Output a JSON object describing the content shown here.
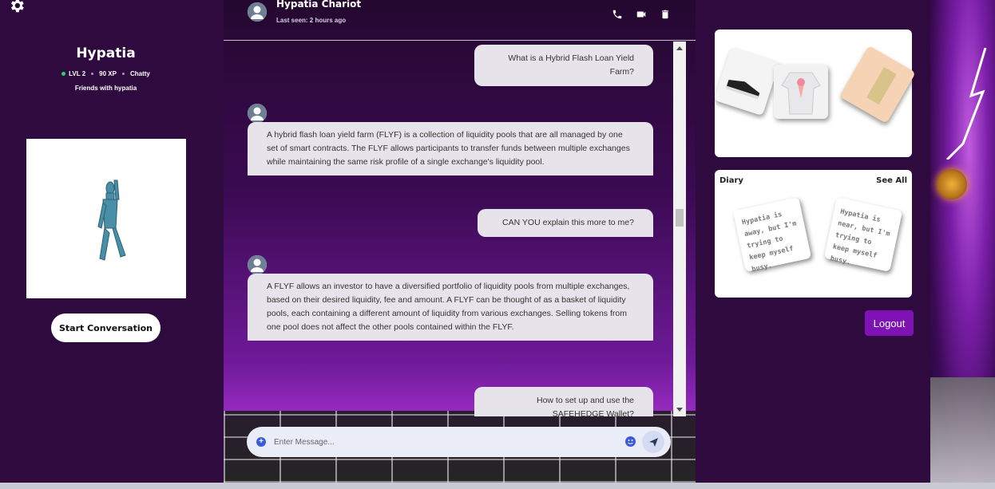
{
  "profile": {
    "name": "Hypatia",
    "level": "LVL 2",
    "xp": "90 XP",
    "mood": "Chatty",
    "friends": "Friends with hypatia",
    "start_button": "Start Conversation"
  },
  "chat": {
    "contact_name": "Hypatia Chariot",
    "last_seen": "Last seen: 2 hours ago",
    "messages": [
      {
        "from": "user",
        "text": "What is a Hybrid Flash Loan Yield Farm?"
      },
      {
        "from": "bot",
        "text": "A hybrid flash loan yield farm (FLYF) is a collection of liquidity pools that are all managed by one set of smart contracts. The FLYF allows participants to transfer funds between multiple exchanges while maintaining the same risk profile of a single exchange's liquidity pool."
      },
      {
        "from": "user",
        "text": "CAN YOU explain this more to me?"
      },
      {
        "from": "bot",
        "text": "A FLYF allows an investor to have a diversified portfolio of liquidity pools from multiple exchanges, based on their desired liquidity, fee and amount. A FLYF can be thought of as a basket of liquidity pools, each containing a different amount of liquidity from various exchanges. Selling tokens from one pool does not affect the other pools contained within the FLYF."
      },
      {
        "from": "user",
        "text": "How to set up and use the SAFEHEDGE Wallet?"
      }
    ],
    "input_placeholder": "Enter Message..."
  },
  "diary": {
    "title": "Diary",
    "see_all": "See All",
    "notes": [
      "Hypatia is away, but I'm trying to keep myself busy.",
      "Hypatia is near, but I'm trying to keep myself busy."
    ]
  },
  "logout_label": "Logout",
  "colors": {
    "panel_bg": "#2f0a3f",
    "bubble_bg": "#e6e4ea",
    "logout_bg": "#7e12b5",
    "accent_blue": "#3b5bd9"
  },
  "icons": [
    "gear-icon",
    "phone-icon",
    "video-icon",
    "trash-icon",
    "plus-icon",
    "emoji-icon",
    "send-icon"
  ]
}
